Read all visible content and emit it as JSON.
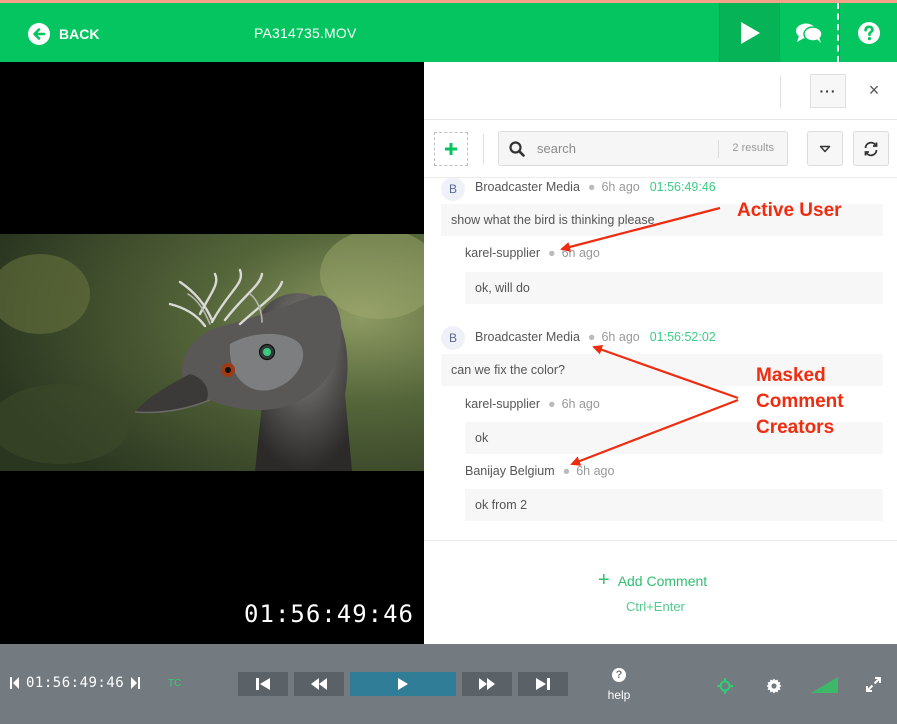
{
  "topbar": {
    "back_label": "BACK",
    "filename": "PA314735.MOV"
  },
  "video": {
    "timecode": "01:56:49:46"
  },
  "panel": {
    "more_label": "···",
    "close_label": "×",
    "search": {
      "placeholder": "search",
      "results": "2 results"
    },
    "comments": [
      {
        "avatar": "B",
        "author": "Broadcaster Media",
        "time": "6h ago",
        "timecode": "01:56:49:46",
        "text": "show what the bird is thinking please",
        "replies": [
          {
            "author": "karel-supplier",
            "time": "6h ago",
            "text": "ok, will do"
          }
        ]
      },
      {
        "avatar": "B",
        "author": "Broadcaster Media",
        "time": "6h ago",
        "timecode": "01:56:52:02",
        "text": "can we fix the color?",
        "replies": [
          {
            "author": "karel-supplier",
            "time": "6h ago",
            "text": "ok"
          },
          {
            "author": "Banijay Belgium",
            "time": "6h ago",
            "text": "ok from 2"
          }
        ]
      }
    ],
    "add_comment_label": "Add Comment",
    "add_comment_shortcut": "Ctrl+Enter"
  },
  "annotations": {
    "active_user": "Active User",
    "masked": [
      "Masked",
      "Comment",
      "Creators"
    ]
  },
  "controls": {
    "timecode": "01:56:49:46",
    "tc_badge": "TC",
    "help_label": "help"
  },
  "colors": {
    "brand_green": "#04c560",
    "annotation_red": "#ee2d10",
    "controls_bg": "#737b80"
  }
}
